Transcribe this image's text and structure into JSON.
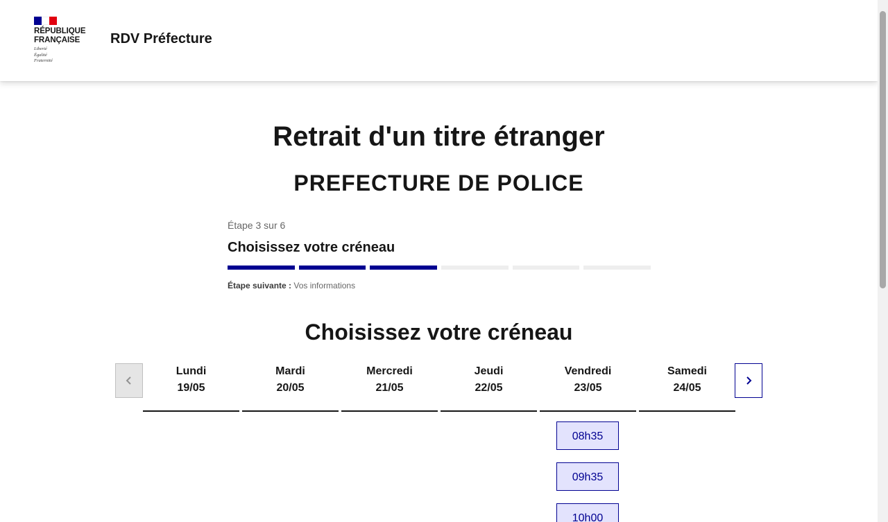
{
  "header": {
    "flag_colors": [
      "#000091",
      "#ffffff",
      "#e1000f"
    ],
    "logo_line1": "RÉPUBLIQUE",
    "logo_line2": "FRANÇAISE",
    "motto1": "Liberté",
    "motto2": "Égalité",
    "motto3": "Fraternité",
    "service_title": "RDV Préfecture"
  },
  "main": {
    "title": "Retrait d'un titre étranger",
    "organization": "PREFECTURE DE POLICE",
    "stepper": {
      "state": "Étape 3 sur 6",
      "current_title": "Choisissez votre créneau",
      "current_step": 3,
      "total_steps": 6,
      "next_label": "Étape suivante :",
      "next_value": " Vos informations"
    },
    "section_title": "Choisissez votre créneau",
    "calendar": {
      "prev_icon": "chevron-left-icon",
      "next_icon": "chevron-right-icon",
      "days": [
        {
          "name": "Lundi",
          "date": "19/05"
        },
        {
          "name": "Mardi",
          "date": "20/05"
        },
        {
          "name": "Mercredi",
          "date": "21/05"
        },
        {
          "name": "Jeudi",
          "date": "22/05"
        },
        {
          "name": "Vendredi",
          "date": "23/05"
        },
        {
          "name": "Samedi",
          "date": "24/05"
        }
      ],
      "slots_day": "Vendredi",
      "slots": [
        "08h35",
        "09h35",
        "10h00"
      ]
    }
  },
  "colors": {
    "accent": "#000091",
    "slot_bg": "#e3e3fd",
    "step_inactive": "#eeeeee"
  }
}
